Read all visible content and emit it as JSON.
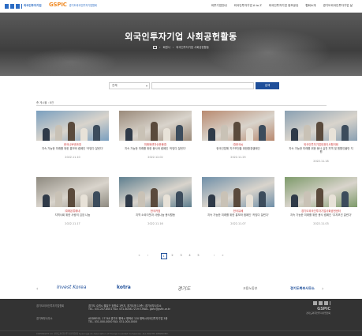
{
  "header": {
    "logo_main": "외국인투자기업",
    "logo_brand": "GSPIC",
    "logo_sub": "경기도외국인투자기업협회",
    "nav": [
      "외투기업안내",
      "외국인투자기업 A to Z",
      "외국인투자기업 정보공유",
      "협회소개",
      "경기도외국인투자기업 날"
    ]
  },
  "hero": {
    "title": "외국인투자기업 사회공헌활동",
    "breadcrumb": [
      "HOME",
      "회원사",
      "외국인투자기업 사회공헌활동"
    ]
  },
  "search": {
    "select_value": "전체",
    "input_value": "",
    "button": "검색"
  },
  "list": {
    "count_label": "총 게시글 : ",
    "count": "총 게시물 : 8건"
  },
  "cards": [
    {
      "title": "한국니토덴코㈜",
      "desc": "지속 가능한 미래를 위한 홍보와 캠페인 '카밍다 잘린다'",
      "date": "2022.11.10",
      "color": "#7a9fbf"
    },
    {
      "title": "미래에셋자산운용㈜",
      "desc": "지속 가능한 미래를 위한 봉사와 캠페인 '카밍다 잘린다'",
      "date": "2022.12.02",
      "color": "#9a8a7a"
    },
    {
      "title": "㈜한국씨",
      "desc": "한국인접해 지구보전을 위한환경캠페인",
      "date": "2022.11.25",
      "color": "#b98a70"
    },
    {
      "title": "외국인투자기업대표이사협의회",
      "desc": "지속 가능한 미래를 위한 봉사 실천 지역 및 원활인물만 지원",
      "date": "2022.11.18",
      "color": "#8aa0b2"
    },
    {
      "title": "㈜에몬류에네",
      "desc": "지역사회 위한 사랑의 김장 나눔",
      "date": "2022.11.17",
      "color": "#8e8a80"
    },
    {
      "title": "한국카컴",
      "desc": "지역 소외이웃과 사랑나눔 봉사활동",
      "date": "2022.11.16",
      "color": "#5f7f8f"
    },
    {
      "title": "한국유베",
      "desc": "지속 가능한 미래를 위한 홍보와 캠페인 '카밍다 잘린다'",
      "date": "2022.11.07",
      "color": "#6f8fa8"
    },
    {
      "title": "경기도외국인투자기업사회공헌센터",
      "desc": "지속 가능한 미래를 위한 봉사 캠페인 '무지보건 잘린다'",
      "date": "2022.11.03",
      "color": "#7d9a6a"
    }
  ],
  "pager": {
    "first": "«",
    "prev": "‹",
    "pages": [
      "1",
      "2",
      "3",
      "4",
      "5"
    ],
    "current": "1",
    "next": "›",
    "last": "»"
  },
  "partners": {
    "prev": "‹",
    "next": "›",
    "logos": [
      "Invest Korea",
      "kotra",
      "경기도",
      "고용노동부",
      "경기도북부사무소"
    ]
  },
  "footer": {
    "label1": "경기도외국인투자기업협회",
    "addr1": "경기도 수원시 팔달구 효원로 1번지, 경기도청 13층 / 경기남부사무소",
    "tel1": "TEL. 031-247-8001   FAX. 031-8008-7219   E-MAIL. gsfic@gsfic.or.kr",
    "label2": "경기북부사무소",
    "addr2": "ADDRESS. 17748 경기도 평택시 평택로 120 평택시외국인투자기업 3층",
    "tel2": "TEL. 031-000-0000   FAX. 031-000-0000",
    "copyright": "COPYRIGHT (C) 경기도외국인투자기업협회 Gyeonggi-do Association of Foreign Invested Companies. ALL RIGHTS RESERVED.",
    "logo_text": "GSPIC",
    "logo_sub": "경기도외국인투자기업협회"
  }
}
